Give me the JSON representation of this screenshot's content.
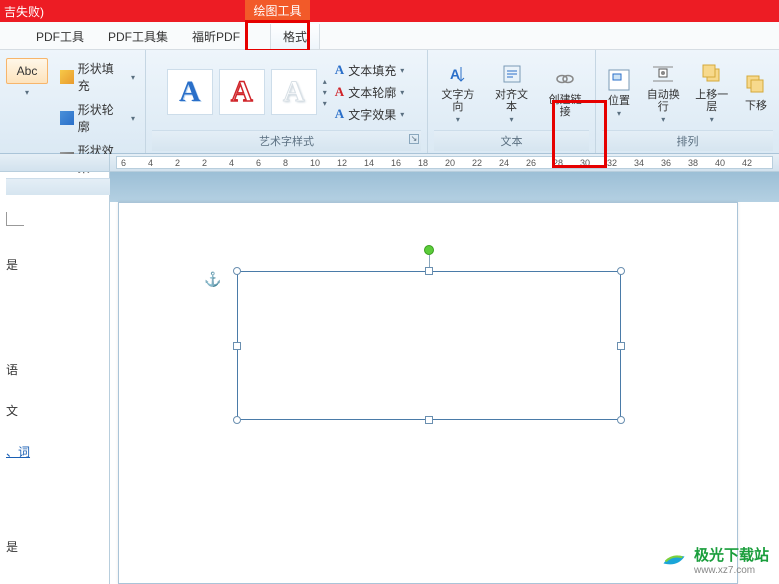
{
  "titlebar": {
    "suffix": "吉失败)"
  },
  "context_tab": "绘图工具",
  "tabs": {
    "t1": "",
    "t2": "PDF工具",
    "t3": "PDF工具集",
    "t4": "福昕PDF",
    "t5": "格式"
  },
  "shape_style": {
    "abc": "Abc",
    "fill": "形状填充",
    "outline": "形状轮廓",
    "effect": "形状效果"
  },
  "wordart": {
    "group_label": "艺术字样式",
    "text_fill": "文本填充",
    "text_outline": "文本轮廓",
    "text_effect": "文字效果"
  },
  "text_group": {
    "label": "文本",
    "direction": "文字方向",
    "align": "对齐文本",
    "link": "创建链接"
  },
  "arrange": {
    "label": "排列",
    "position": "位置",
    "wrap": "自动换行",
    "bring_forward": "上移一层",
    "send_backward": "下移"
  },
  "ruler": {
    "nums": [
      "6",
      "4",
      "2",
      "2",
      "4",
      "6",
      "8",
      "10",
      "12",
      "14",
      "16",
      "18",
      "20",
      "22",
      "24",
      "26",
      "28",
      "30",
      "32",
      "34",
      "36",
      "38",
      "40",
      "42"
    ]
  },
  "sidebar": {
    "i1": "是",
    "i2": "语",
    "i3": "文",
    "i4": "、词",
    "i5": "是"
  },
  "watermark": {
    "name": "极光下载站",
    "url": "www.xz7.com"
  }
}
